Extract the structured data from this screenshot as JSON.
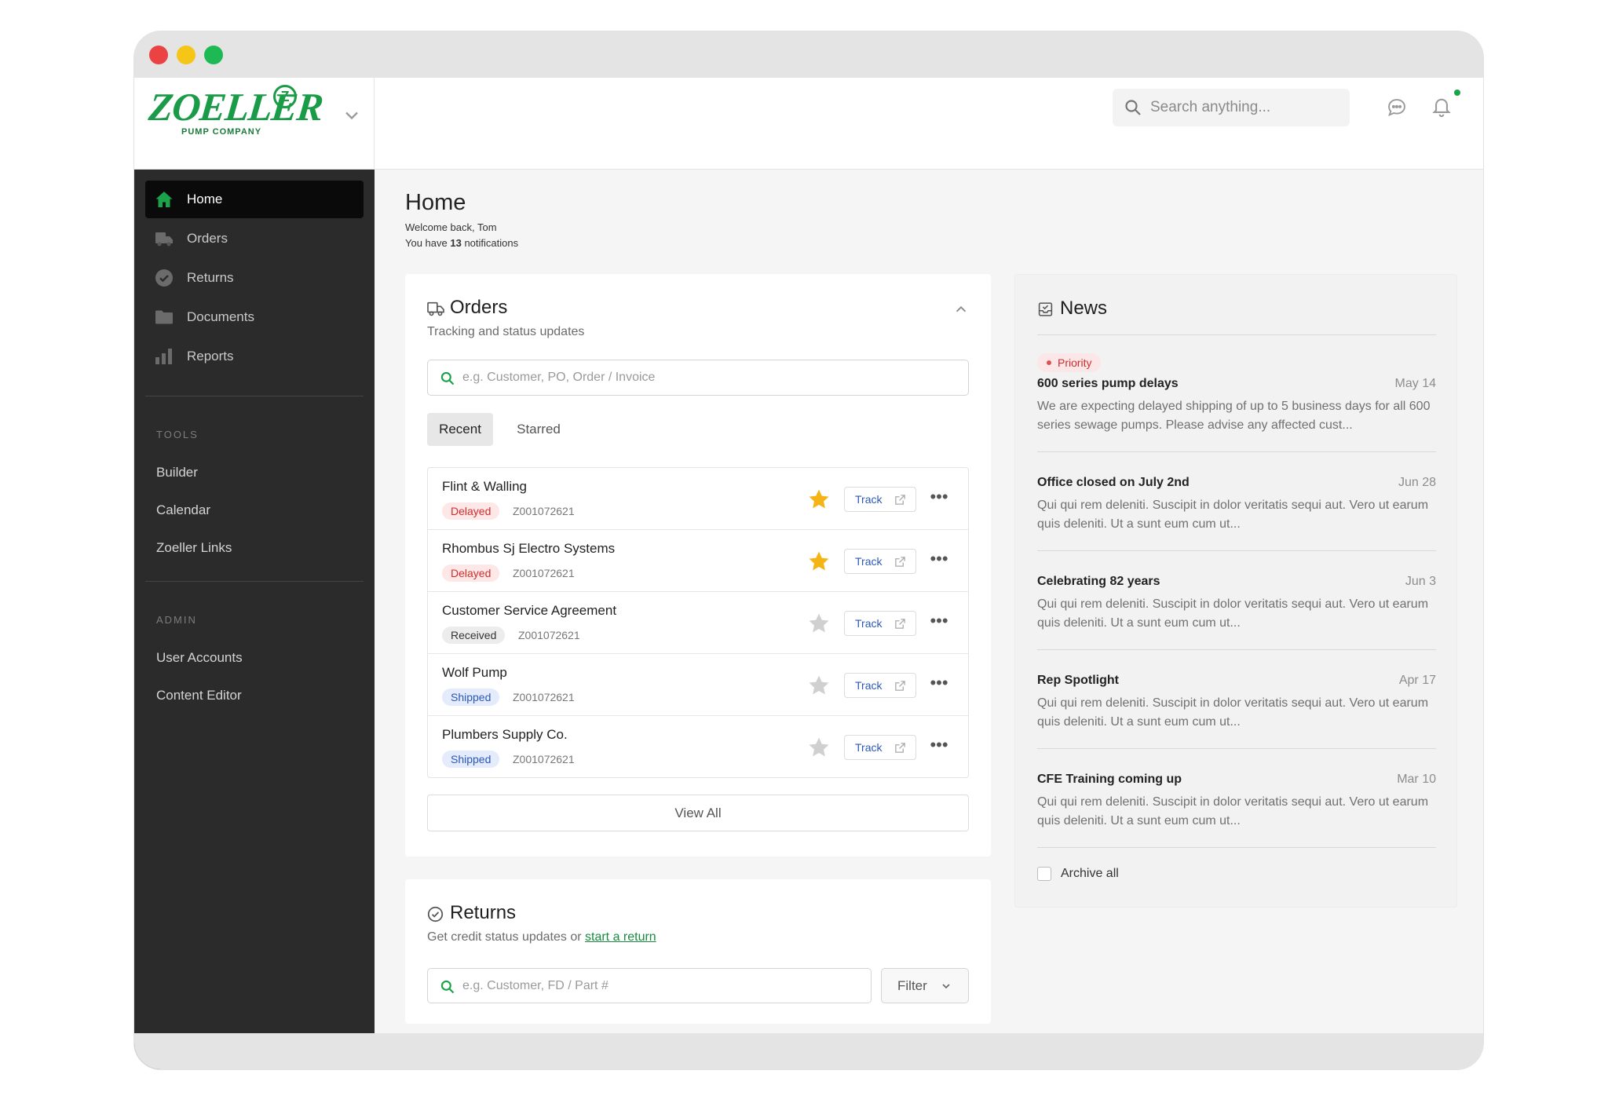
{
  "brand": {
    "logo_text": "ZOELLER",
    "logo_sub": "PUMP COMPANY",
    "accent": "#1a9b47"
  },
  "header": {
    "search_placeholder": "Search anything..."
  },
  "sidebar": {
    "items": [
      {
        "label": "Home",
        "icon": "home-icon"
      },
      {
        "label": "Orders",
        "icon": "truck-icon"
      },
      {
        "label": "Returns",
        "icon": "check-circle-icon"
      },
      {
        "label": "Documents",
        "icon": "folder-icon"
      },
      {
        "label": "Reports",
        "icon": "bar-chart-icon"
      }
    ],
    "tools_heading": "TOOLS",
    "tools": [
      "Builder",
      "Calendar",
      "Zoeller Links"
    ],
    "admin_heading": "ADMIN",
    "admin": [
      "User Accounts",
      "Content Editor"
    ]
  },
  "page": {
    "title": "Home",
    "welcome": "Welcome back, Tom",
    "notif_prefix": "You have ",
    "notif_count": "13",
    "notif_suffix": " notifications"
  },
  "orders": {
    "title": "Orders",
    "subtitle": "Tracking and status updates",
    "search_placeholder": "e.g. Customer, PO, Order / Invoice",
    "tabs": [
      "Recent",
      "Starred"
    ],
    "track_label": "Track",
    "view_all": "View All",
    "rows": [
      {
        "name": "Flint & Walling",
        "status": "Delayed",
        "number": "Z001072621",
        "starred": true
      },
      {
        "name": "Rhombus Sj Electro Systems",
        "status": "Delayed",
        "number": "Z001072621",
        "starred": true
      },
      {
        "name": "Customer Service Agreement",
        "status": "Received",
        "number": "Z001072621",
        "starred": false
      },
      {
        "name": "Wolf Pump",
        "status": "Shipped",
        "number": "Z001072621",
        "starred": false
      },
      {
        "name": "Plumbers Supply Co.",
        "status": "Shipped",
        "number": "Z001072621",
        "starred": false
      }
    ]
  },
  "returns": {
    "title": "Returns",
    "subtitle_prefix": "Get credit status updates or ",
    "subtitle_link": "start a return",
    "search_placeholder": "e.g. Customer, FD / Part #",
    "filter_label": "Filter"
  },
  "news": {
    "title": "News",
    "priority_label": "Priority",
    "items": [
      {
        "title": "600 series pump delays",
        "date": "May 14",
        "body": "We are expecting delayed shipping of up to 5 business days for all 600 series sewage pumps. Please advise any affected cust..."
      },
      {
        "title": "Office closed on July 2nd",
        "date": "Jun 28",
        "body": "Qui qui rem deleniti. Suscipit in dolor veritatis sequi aut. Vero ut earum quis deleniti. Ut a sunt eum cum ut..."
      },
      {
        "title": "Celebrating 82 years",
        "date": "Jun 3",
        "body": "Qui qui rem deleniti. Suscipit in dolor veritatis sequi aut. Vero ut earum quis deleniti. Ut a sunt eum cum ut..."
      },
      {
        "title": "Rep Spotlight",
        "date": "Apr 17",
        "body": "Qui qui rem deleniti. Suscipit in dolor veritatis sequi aut. Vero ut earum quis deleniti. Ut a sunt eum cum ut..."
      },
      {
        "title": "CFE Training coming up",
        "date": "Mar 10",
        "body": "Qui qui rem deleniti. Suscipit in dolor veritatis sequi aut. Vero ut earum quis deleniti. Ut a sunt eum cum ut..."
      }
    ],
    "archive_label": "Archive all"
  },
  "colors": {
    "accent_green": "#1aa34a",
    "sidebar_bg": "#2b2b2c",
    "star_active": "#f5b416",
    "star_inactive": "#d0d0d0",
    "delayed": "#cf2d2d",
    "shipped": "#2b58b8"
  }
}
